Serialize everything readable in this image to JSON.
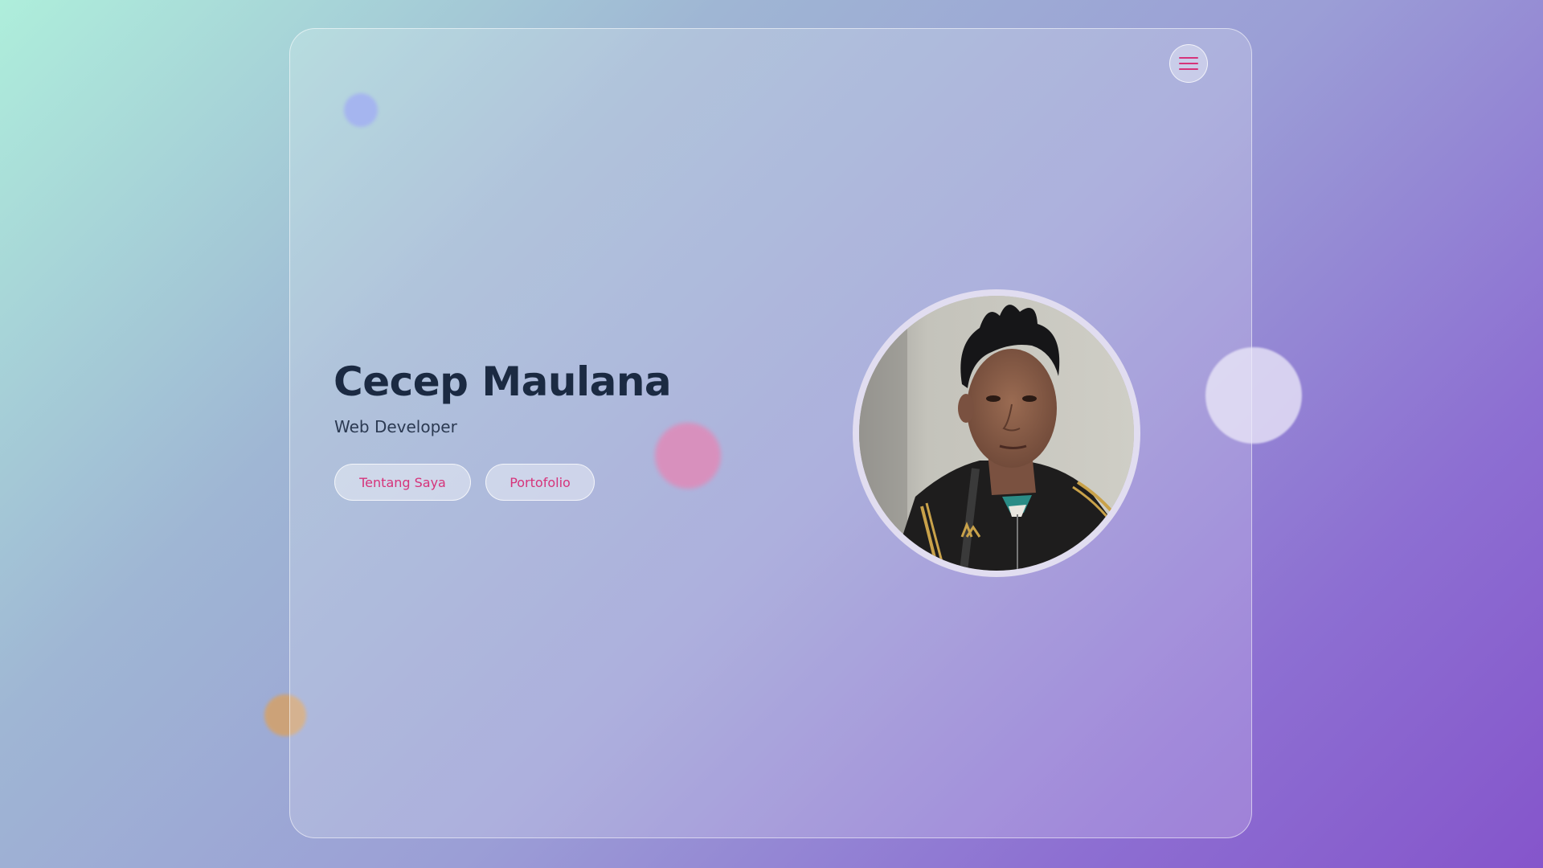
{
  "profile": {
    "name": "Cecep Maulana",
    "role": "Web Developer"
  },
  "actions": {
    "about_label": "Tentang Saya",
    "portfolio_label": "Portofolio"
  },
  "menu": {
    "icon": "hamburger-menu-icon"
  },
  "colors": {
    "accent": "#d6337a",
    "heading": "#1b2a42",
    "text": "#2c3a52",
    "background_start": "#aeeedb",
    "background_end": "#8555cb"
  }
}
